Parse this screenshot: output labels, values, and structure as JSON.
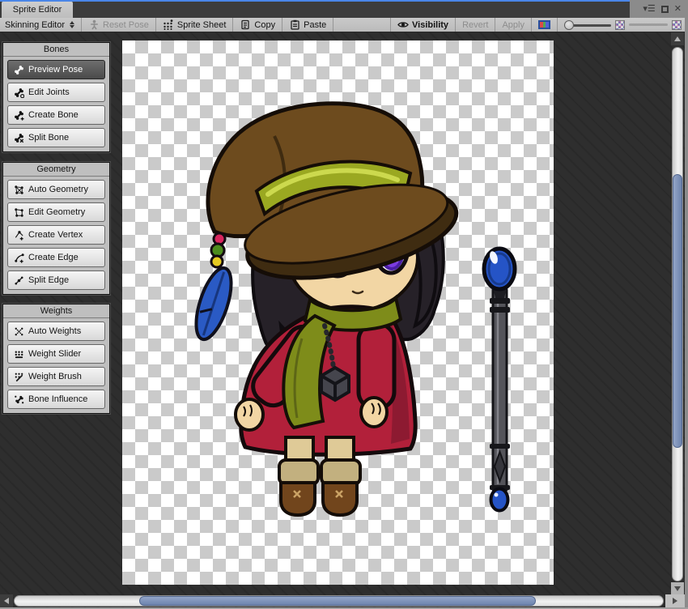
{
  "window": {
    "tab_title": "Sprite Editor",
    "accent_color": "#4a86e8",
    "controls": {
      "menu": "dropdown-menu-icon",
      "maximize": "maximize-icon",
      "close": "close-icon"
    }
  },
  "toolbar": {
    "mode_dropdown_label": "Skinning Editor",
    "reset_pose_label": "Reset Pose",
    "sprite_sheet_label": "Sprite Sheet",
    "copy_label": "Copy",
    "paste_label": "Paste",
    "visibility_label": "Visibility",
    "revert_label": "Revert",
    "apply_label": "Apply",
    "disabled_buttons": [
      "Reset Pose",
      "Revert",
      "Apply"
    ],
    "rgb_swatch_colors": [
      "#d84a4a",
      "#52a852",
      "#5262d8"
    ]
  },
  "sidebar": {
    "groups": [
      {
        "title": "Bones",
        "items": [
          {
            "label": "Preview Pose",
            "icon": "preview-pose-bone-icon",
            "active": true
          },
          {
            "label": "Edit Joints",
            "icon": "edit-joints-bone-icon",
            "active": false
          },
          {
            "label": "Create Bone",
            "icon": "create-bone-icon",
            "active": false
          },
          {
            "label": "Split Bone",
            "icon": "split-bone-icon",
            "active": false
          }
        ]
      },
      {
        "title": "Geometry",
        "items": [
          {
            "label": "Auto Geometry",
            "icon": "auto-geometry-icon",
            "active": false
          },
          {
            "label": "Edit Geometry",
            "icon": "edit-geometry-icon",
            "active": false
          },
          {
            "label": "Create Vertex",
            "icon": "create-vertex-icon",
            "active": false
          },
          {
            "label": "Create Edge",
            "icon": "create-edge-icon",
            "active": false
          },
          {
            "label": "Split Edge",
            "icon": "split-edge-icon",
            "active": false
          }
        ]
      },
      {
        "title": "Weights",
        "items": [
          {
            "label": "Auto Weights",
            "icon": "auto-weights-icon",
            "active": false
          },
          {
            "label": "Weight Slider",
            "icon": "weight-slider-icon",
            "active": false
          },
          {
            "label": "Weight Brush",
            "icon": "weight-brush-icon",
            "active": false
          },
          {
            "label": "Bone Influence",
            "icon": "bone-influence-icon",
            "active": false
          }
        ]
      }
    ]
  },
  "canvas": {
    "content": "Chibi witch sprite: brown pointed hat with olive band, hanging beads and blue feather, black hair, large purple eyes, olive scarf, red dress, Unity-cube pendant, tan legs, brown boots; separate staff with blue orbs",
    "checker_light": "#ffffff",
    "checker_dark": "#cacaca",
    "palette": {
      "hat_brown": "#6d4b1e",
      "hat_shadow": "#4c3513",
      "band_olive": "#9aa821",
      "hair_black": "#262128",
      "skin": "#f2d6a4",
      "iris_purple": "#7b3be0",
      "scarf_olive": "#7e8c1a",
      "dress_red": "#b2203a",
      "boot_brown": "#71451c",
      "feather_blue": "#2a5ac4",
      "staff_gray": "#54545a",
      "orb_blue": "#2554c6"
    }
  },
  "scrollbars": {
    "thumb_color": "#7b8fb8"
  }
}
